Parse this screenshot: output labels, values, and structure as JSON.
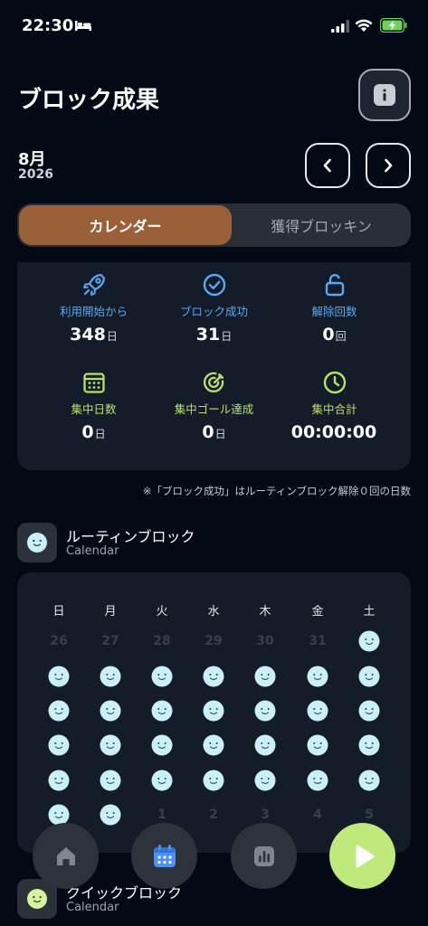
{
  "status": {
    "time": "22:30"
  },
  "header": {
    "title": "ブロック成果"
  },
  "period": {
    "month": "8月",
    "year": "2026"
  },
  "segments": {
    "active": "カレンダー",
    "inactive": "獲得ブロッキン"
  },
  "stats": [
    {
      "label": "利用開始から",
      "value": "348",
      "unit": "日",
      "icon": "rocket-icon"
    },
    {
      "label": "ブロック成功",
      "value": "31",
      "unit": "日",
      "icon": "check-circle-icon"
    },
    {
      "label": "解除回数",
      "value": "0",
      "unit": "回",
      "icon": "unlock-icon"
    },
    {
      "label": "集中日数",
      "value": "0",
      "unit": "日",
      "icon": "calendar-grid-icon"
    },
    {
      "label": "集中ゴール達成",
      "value": "0",
      "unit": "日",
      "icon": "target-icon"
    },
    {
      "label": "集中合計",
      "value": "00:00:00",
      "unit": "",
      "icon": "clock-icon"
    }
  ],
  "footnote": "※「ブロック成功」はルーティンブロック解除０回の日数",
  "routine": {
    "title": "ルーティンブロック",
    "subtitle": "Calendar"
  },
  "quick": {
    "title": "クイックブロック",
    "subtitle": "Calendar"
  },
  "calendar": {
    "weekdays": [
      "日",
      "月",
      "火",
      "水",
      "木",
      "金",
      "土"
    ],
    "leading_days": [
      "26",
      "27",
      "28",
      "29",
      "30",
      "31"
    ],
    "trailing_days": [
      "1",
      "2",
      "3",
      "4",
      "5"
    ],
    "month_days_shown": 31,
    "success_face_color": "#c9f0f8"
  },
  "tabs": [
    {
      "icon": "home-icon"
    },
    {
      "icon": "calendar-icon"
    },
    {
      "icon": "bar-chart-icon"
    },
    {
      "icon": "play-icon"
    }
  ],
  "colors": {
    "accent_brown": "#9a6138",
    "accent_green": "#bdea7a",
    "accent_blue": "#5aa8ef"
  }
}
